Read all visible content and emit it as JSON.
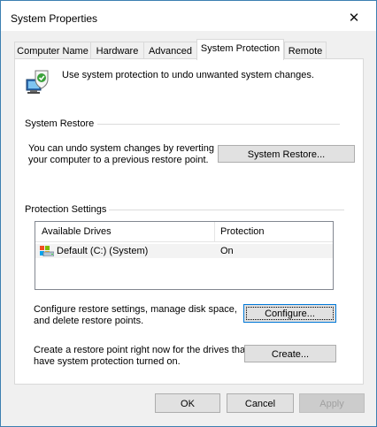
{
  "window": {
    "title": "System Properties"
  },
  "tabs": [
    {
      "label": "Computer Name"
    },
    {
      "label": "Hardware"
    },
    {
      "label": "Advanced"
    },
    {
      "label": "System Protection"
    },
    {
      "label": "Remote"
    }
  ],
  "intro": {
    "text": "Use system protection to undo unwanted system changes."
  },
  "system_restore": {
    "heading": "System Restore",
    "line1": "You can undo system changes by reverting",
    "line2": "your computer to a previous restore point.",
    "button": "System Restore..."
  },
  "protection": {
    "heading": "Protection Settings",
    "columns": [
      "Available Drives",
      "Protection"
    ],
    "rows": [
      {
        "drive": "Default (C:) (System)",
        "protection": "On"
      }
    ]
  },
  "configure": {
    "line1": "Configure restore settings, manage disk space,",
    "line2": "and delete restore points.",
    "button": "Configure..."
  },
  "create": {
    "line1": "Create a restore point right now for the drives that",
    "line2": "have system protection turned on.",
    "button": "Create..."
  },
  "footer": {
    "ok": "OK",
    "cancel": "Cancel",
    "apply": "Apply"
  },
  "colors": {
    "accent": "#0078d7",
    "window_border": "#3c7fb1"
  },
  "icons": {
    "close": "close-icon",
    "intro": "system-protection-icon",
    "drive": "hard-drive-icon"
  }
}
